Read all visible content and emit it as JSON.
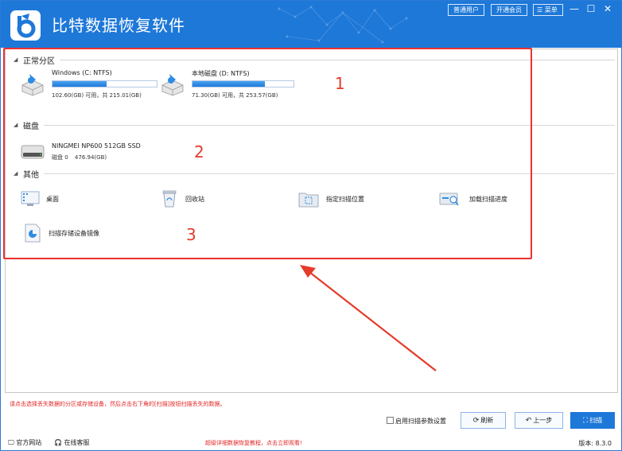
{
  "app": {
    "title": "比特数据恢复软件",
    "user_type_label": "普通用户",
    "vip_label": "开通会员",
    "menu_label": "菜单",
    "minimize": "—",
    "maximize": "☐",
    "close": "✕"
  },
  "sections": {
    "normal_partitions": "正常分区",
    "disks": "磁盘",
    "others": "其他"
  },
  "partitions": [
    {
      "name": "Windows (C: NTFS)",
      "size": "102.60(GB) 可用，共 215.01(GB)",
      "used_fraction": 0.52
    },
    {
      "name": "本地磁盘 (D: NTFS)",
      "size": "71.30(GB) 可用，共 253.57(GB)",
      "used_fraction": 0.72
    }
  ],
  "disk": {
    "name": "NINGMEI NP600 512GB SSD",
    "id": "磁盘 0",
    "size": "476.94(GB)"
  },
  "others": [
    {
      "label": "桌面",
      "icon": "desktop-icon"
    },
    {
      "label": "回收站",
      "icon": "recycle-bin-icon"
    },
    {
      "label": "指定扫描位置",
      "icon": "folder-scan-icon"
    },
    {
      "label": "加载扫描进度",
      "icon": "load-progress-icon"
    },
    {
      "label": "扫描存储设备镜像",
      "icon": "disk-image-icon"
    }
  ],
  "annotations": {
    "n1": "1",
    "n2": "2",
    "n3": "3"
  },
  "bottom": {
    "hint": "请点击选择丢失数据的分区或存储设备，然后点击右下角的[扫描]按钮扫描丢失的数据。",
    "enable_scan_params": "启用扫描参数设置",
    "refresh": "刷新",
    "prev": "上一步",
    "scan": "扫描"
  },
  "footer": {
    "website": "官方网站",
    "support": "在线客服",
    "promo": "超级详细数据恢复教程，点击立即观看!",
    "version": "版本: 8.3.0"
  },
  "colors": {
    "accent": "#1e78d8",
    "annotation_red": "#e53b2b"
  }
}
